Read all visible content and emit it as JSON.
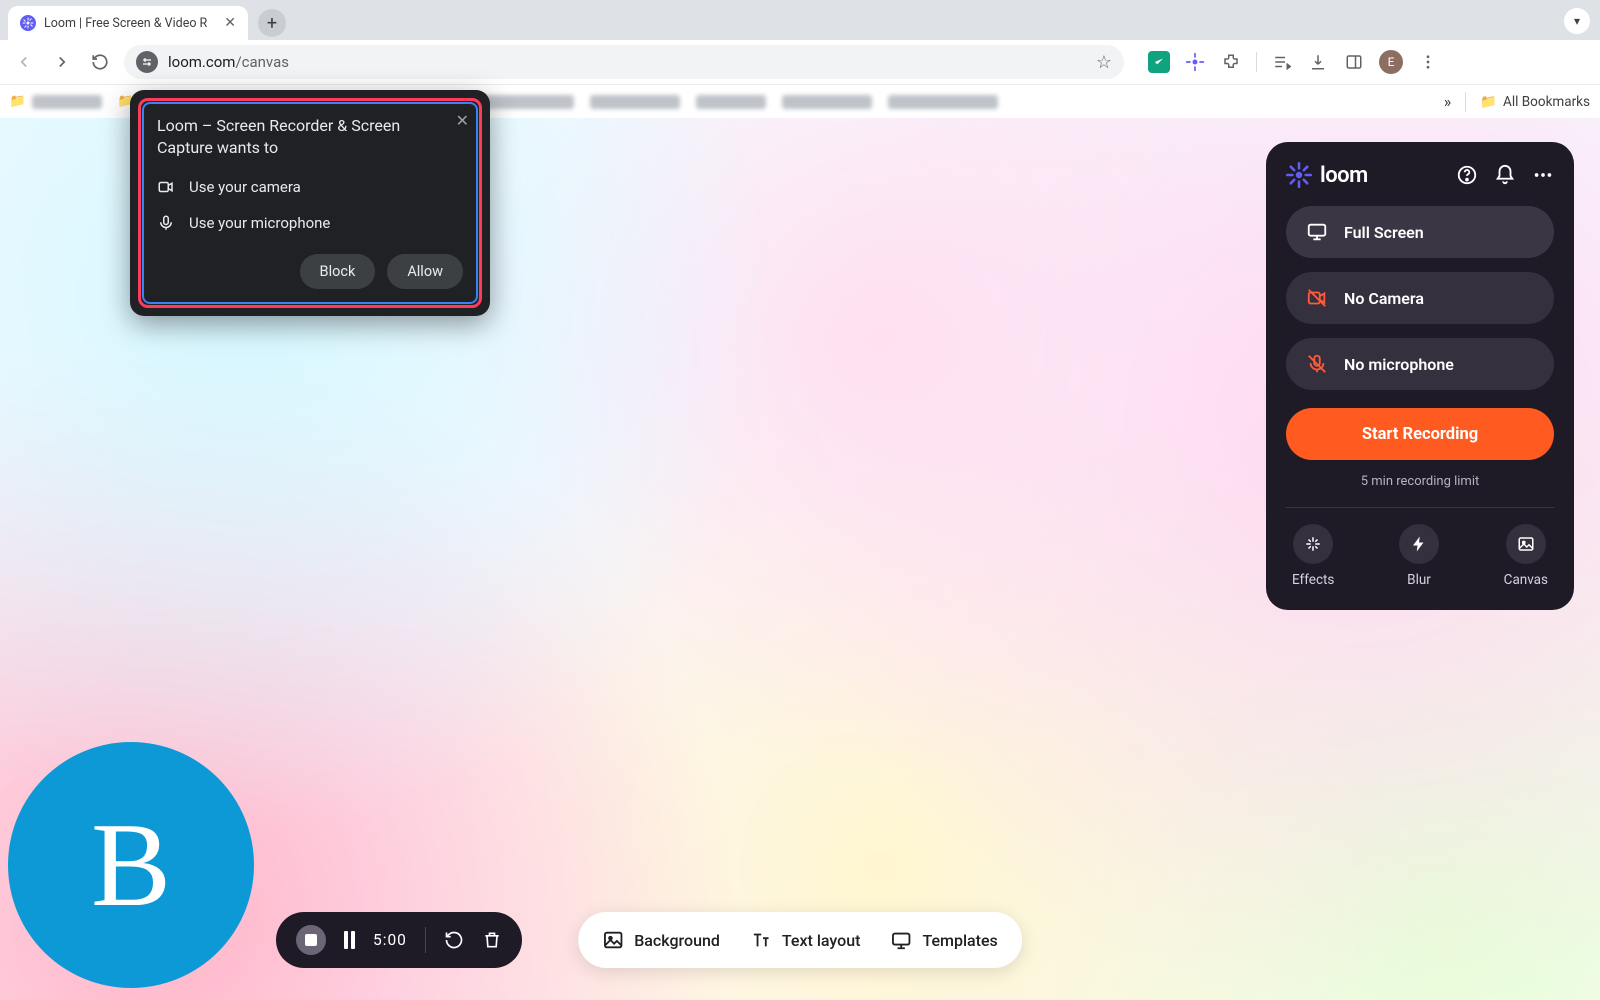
{
  "browser": {
    "tab_title": "Loom | Free Screen & Video R",
    "url_host": "loom.com",
    "url_path": "/canvas",
    "all_bookmarks": "All Bookmarks",
    "avatar_letter": "E"
  },
  "permission_dialog": {
    "title": "Loom – Screen Recorder & Screen Capture wants to",
    "camera": "Use your camera",
    "microphone": "Use your microphone",
    "block": "Block",
    "allow": "Allow"
  },
  "loom_panel": {
    "brand": "loom",
    "full_screen": "Full Screen",
    "no_camera": "No Camera",
    "no_microphone": "No microphone",
    "start": "Start Recording",
    "limit": "5 min recording limit",
    "tools": {
      "effects": "Effects",
      "blur": "Blur",
      "canvas": "Canvas"
    }
  },
  "camera_bubble": {
    "letter": "B"
  },
  "rec_bar": {
    "time": "5:00"
  },
  "bottom_bar": {
    "background": "Background",
    "text_layout": "Text layout",
    "templates": "Templates"
  }
}
